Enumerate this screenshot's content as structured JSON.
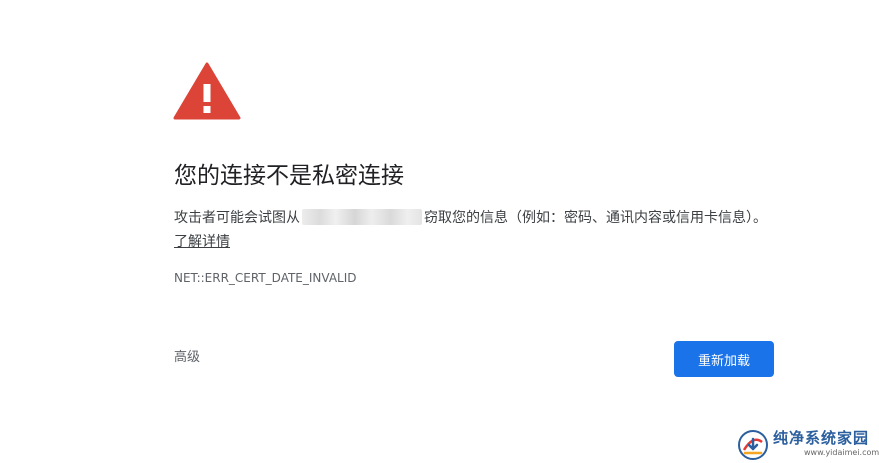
{
  "error_page": {
    "icon": "warning-triangle-icon",
    "heading": "您的连接不是私密连接",
    "body_before": "攻击者可能会试图从",
    "body_after": "窃取您的信息（例如：密码、通讯内容或信用卡信息）。",
    "learn_more": "了解详情",
    "error_code": "NET::ERR_CERT_DATE_INVALID",
    "advanced_label": "高级",
    "reload_label": "重新加载"
  },
  "watermark": {
    "name": "纯净系统家园",
    "url": "www.yidaimei.com"
  },
  "colors": {
    "warning_red": "#db4437",
    "button_blue": "#1a73e8",
    "text_dark": "#202124",
    "text_body": "#3c4043",
    "text_muted": "#5f6368"
  }
}
